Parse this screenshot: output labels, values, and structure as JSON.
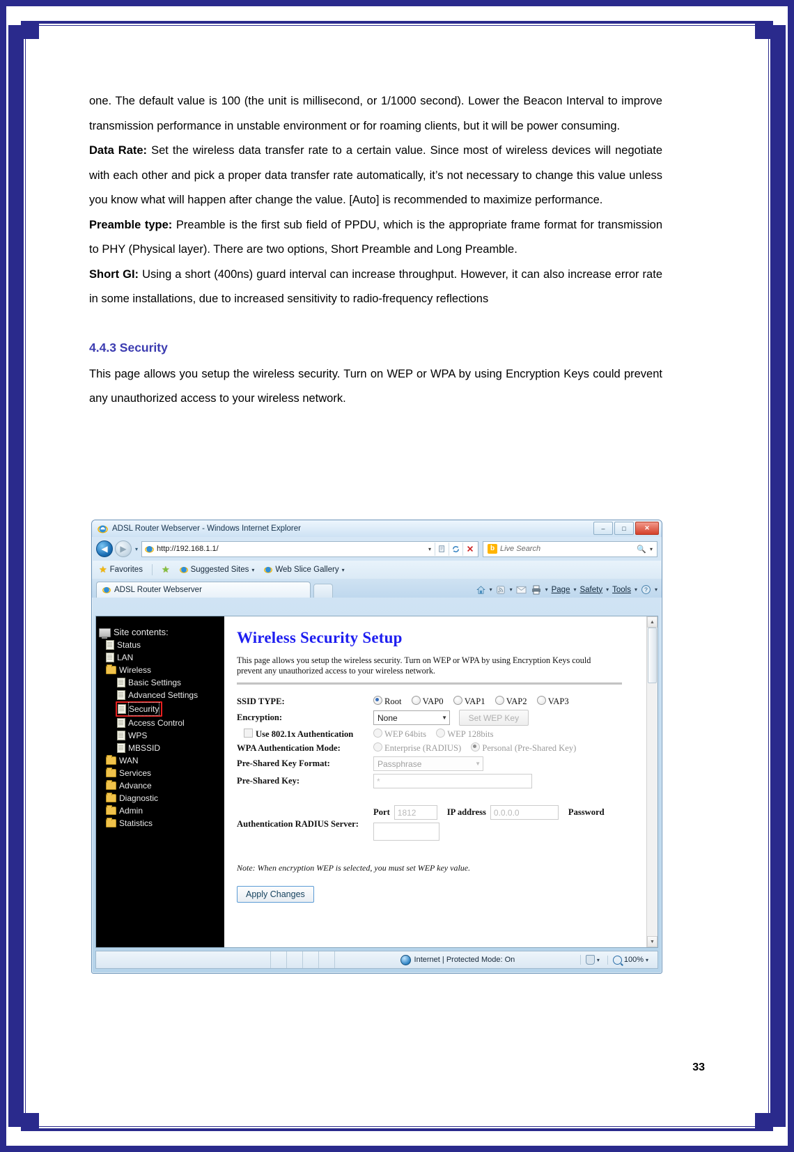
{
  "document": {
    "paragraphs": [
      "one. The default value is 100 (the unit is millisecond, or 1/1000 second). Lower the Beacon Interval to improve transmission performance in unstable environment or for roaming clients, but it will be power consuming.",
      "Set the wireless data transfer rate to a certain value. Since most of wireless devices will negotiate with each other and pick a proper data transfer rate automatically, it’s not necessary to change this value unless you know what will happen after change the value. [Auto] is recommended to maximize performance.",
      "Preamble is the first sub field of PPDU, which is the appropriate frame format for transmission to PHY (Physical layer). There are two options, Short Preamble and Long Preamble.",
      "Using a short (400ns) guard interval can increase throughput. However, it can also increase error rate in some installations, due to increased sensitivity to radio-frequency reflections"
    ],
    "bold_leads": {
      "data_rate": "Data Rate:",
      "preamble": "Preamble type:",
      "short_gi": "Short GI:"
    },
    "section_heading": "4.4.3 Security",
    "section_intro": "This page allows you setup the wireless security. Turn on WEP or WPA by using Encryption Keys could prevent any unauthorized access to your wireless network.",
    "page_number": "33"
  },
  "browser": {
    "title": "ADSL Router Webserver - Windows Internet Explorer",
    "window_buttons": {
      "minimize": "–",
      "maximize": "□",
      "close": "✕"
    },
    "address": {
      "url": "http://192.168.1.1/",
      "dropdown_caret": "▾",
      "refresh_icon": "refresh-icon",
      "stop_icon": "✕"
    },
    "search": {
      "placeholder": "Live Search",
      "provider": "bing-icon",
      "provider_letter": "b"
    },
    "favorites_bar": {
      "favorites_label": "Favorites",
      "items": [
        {
          "label": "Suggested Sites",
          "caret": "▾"
        },
        {
          "label": "Web Slice Gallery",
          "caret": "▾"
        }
      ]
    },
    "tab": {
      "label": "ADSL Router Webserver"
    },
    "command_bar": {
      "home": "home-icon",
      "feeds": "rss-icon",
      "mail": "mail-icon",
      "print": "printer-icon",
      "menus": [
        "Page",
        "Safety",
        "Tools"
      ],
      "help": "help-icon",
      "caret": "▾"
    },
    "status_bar": {
      "zone": "Internet | Protected Mode: On",
      "zoom": "100%",
      "caret": "▾"
    }
  },
  "router_page": {
    "tree": {
      "root": "Site contents:",
      "items": [
        {
          "label": "Status",
          "type": "doc",
          "level": 1
        },
        {
          "label": "LAN",
          "type": "doc",
          "level": 1
        },
        {
          "label": "Wireless",
          "type": "folder-open",
          "level": 1
        },
        {
          "label": "Basic Settings",
          "type": "doc",
          "level": 2
        },
        {
          "label": "Advanced Settings",
          "type": "doc",
          "level": 2
        },
        {
          "label": "Security",
          "type": "doc",
          "level": 2,
          "selected": true
        },
        {
          "label": "Access Control",
          "type": "doc",
          "level": 2
        },
        {
          "label": "WPS",
          "type": "doc",
          "level": 2
        },
        {
          "label": "MBSSID",
          "type": "doc",
          "level": 2
        },
        {
          "label": "WAN",
          "type": "folder",
          "level": 1
        },
        {
          "label": "Services",
          "type": "folder",
          "level": 1
        },
        {
          "label": "Advance",
          "type": "folder",
          "level": 1
        },
        {
          "label": "Diagnostic",
          "type": "folder",
          "level": 1
        },
        {
          "label": "Admin",
          "type": "folder",
          "level": 1
        },
        {
          "label": "Statistics",
          "type": "folder",
          "level": 1
        }
      ]
    },
    "form": {
      "title": "Wireless Security Setup",
      "description": "This page allows you setup the wireless security. Turn on WEP or WPA by using Encryption Keys could prevent any unauthorized access to your wireless network.",
      "ssid_type": {
        "label": "SSID TYPE:",
        "options": [
          "Root",
          "VAP0",
          "VAP1",
          "VAP2",
          "VAP3"
        ],
        "selected": "Root"
      },
      "encryption": {
        "label": "Encryption:",
        "value": "None",
        "set_wep_key_button": "Set WEP Key"
      },
      "dot1x": {
        "label": "Use 802.1x Authentication",
        "checked": false,
        "wep_options": [
          "WEP 64bits",
          "WEP 128bits"
        ],
        "wep_selected": ""
      },
      "wpa_auth_mode": {
        "label": "WPA Authentication Mode:",
        "options": [
          "Enterprise (RADIUS)",
          "Personal (Pre-Shared Key)"
        ],
        "selected": "Personal (Pre-Shared Key)"
      },
      "psk_format": {
        "label": "Pre-Shared Key Format:",
        "value": "Passphrase"
      },
      "psk": {
        "label": "Pre-Shared Key:",
        "value": "*"
      },
      "radius": {
        "label": "Authentication RADIUS Server:",
        "port_label": "Port",
        "port_value": "1812",
        "ip_label": "IP address",
        "ip_value": "0.0.0.0",
        "password_label": "Password",
        "password_value": ""
      },
      "note": "Note: When encryption WEP is selected, you must set WEP key value.",
      "apply_button": "Apply Changes"
    }
  }
}
